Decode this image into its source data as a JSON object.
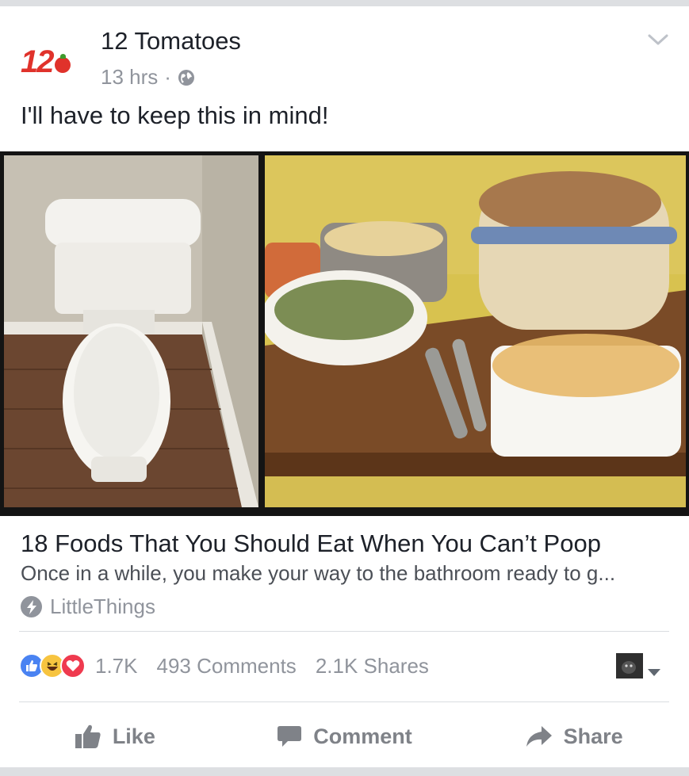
{
  "post": {
    "avatar_text": "12",
    "page_name": "12 Tomatoes",
    "time": "13 hrs",
    "separator": "·",
    "privacy_icon": "globe-icon",
    "options_icon": "chevron-down-icon",
    "text": "I'll have to keep this in mind!"
  },
  "link": {
    "title": "18 Foods That You Should Eat When You Can’t Poop",
    "description": "Once in a while, you make your way to the bathroom ready to g...",
    "source": "LittleThings",
    "source_icon": "lightning-bolt-icon"
  },
  "stats": {
    "reaction_icons": [
      "like-reaction-icon",
      "haha-reaction-icon",
      "love-reaction-icon"
    ],
    "reactions_count": "1.7K",
    "comments": "493 Comments",
    "shares": "2.1K Shares"
  },
  "actions": {
    "like": "Like",
    "comment": "Comment",
    "share": "Share"
  },
  "colors": {
    "brand_red": "#e0322b",
    "like_blue": "#4a83f2",
    "love_red": "#ef3a4f",
    "haha_yellow": "#f7c440",
    "meta_gray": "#90949c"
  }
}
